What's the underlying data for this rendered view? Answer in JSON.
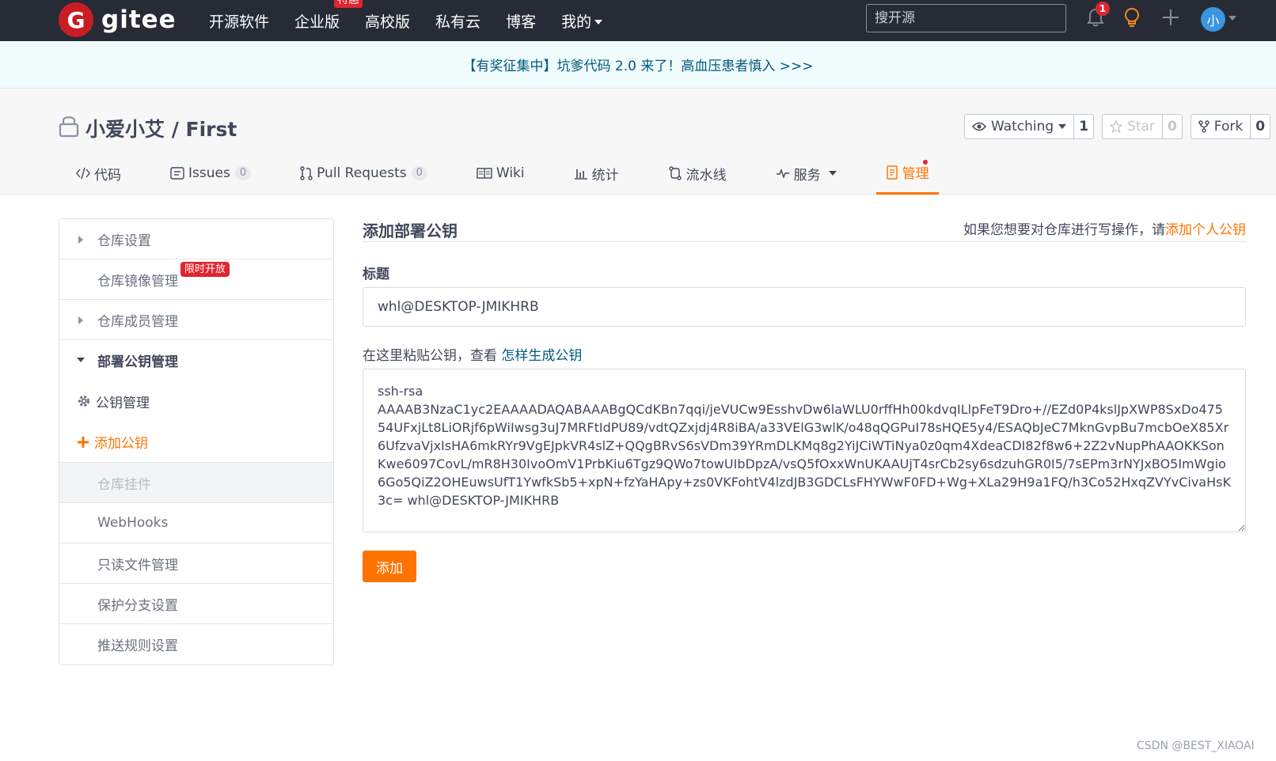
{
  "navbar": {
    "logo_letter": "G",
    "logo_text": "gitee",
    "links": [
      {
        "label": "开源软件"
      },
      {
        "label": "企业版",
        "badge": "特惠"
      },
      {
        "label": "高校版"
      },
      {
        "label": "私有云"
      },
      {
        "label": "博客"
      },
      {
        "label": "我的"
      }
    ],
    "search_placeholder": "搜开源",
    "notification_count": "1",
    "avatar_text": "小",
    "icons": [
      "bell-icon",
      "lightbulb-icon",
      "plus-icon"
    ]
  },
  "announcement": {
    "text": "【有奖征集中】坑爹代码 2.0 来了！高血压患者慎入 >>>"
  },
  "repo": {
    "title": "小爱小艾 / First",
    "watch_label": "Watching",
    "watch_count": "1",
    "star_label": "Star",
    "star_count": "0",
    "fork_label": "Fork",
    "fork_count": "0",
    "tabs": [
      {
        "label": "代码",
        "icon": "code-icon"
      },
      {
        "label": "Issues",
        "count": "0",
        "icon": "issues-icon"
      },
      {
        "label": "Pull Requests",
        "count": "0",
        "icon": "pull-request-icon"
      },
      {
        "label": "Wiki",
        "icon": "book-icon"
      },
      {
        "label": "统计",
        "icon": "bar-chart-icon"
      },
      {
        "label": "流水线",
        "icon": "pipeline-icon"
      },
      {
        "label": "服务",
        "icon": "pulse-icon"
      },
      {
        "label": "管理",
        "icon": "manage-icon",
        "active": true
      }
    ]
  },
  "sidebar": {
    "items": [
      {
        "label": "仓库设置"
      },
      {
        "label": "仓库镜像管理",
        "badge": "限时开放"
      },
      {
        "label": "仓库成员管理"
      },
      {
        "label": "部署公钥管理"
      },
      {
        "label": "公钥管理"
      },
      {
        "label": "添加公钥"
      },
      {
        "label": "仓库挂件"
      },
      {
        "label": "WebHooks"
      },
      {
        "label": "只读文件管理"
      },
      {
        "label": "保护分支设置"
      },
      {
        "label": "推送规则设置"
      }
    ]
  },
  "form": {
    "heading": "添加部署公钥",
    "hint_prefix": "如果您想要对仓库进行写操作，请",
    "hint_link": "添加个人公钥",
    "title_label": "标题",
    "title_value": "whl@DESKTOP-JMIKHRB",
    "key_label_prefix": "在这里粘贴公钥，查看",
    "key_label_link": "怎样生成公钥",
    "key_value": "ssh-rsa\nAAAAB3NzaC1yc2EAAAADAQABAAABgQCdKBn7qqi/jeVUCw9EsshvDw6laWLU0rffHh00kdvqILlpFeT9Dro+//EZd0P4kslJpXWP8SxDo47554UFxjLt8LiORjf6pWiIwsg3uJ7MRFtIdPU89/vdtQZxjdj4R8iBA/a33VElG3wlK/o48qQGPuI78sHQE5y4/ESAQbJeC7MknGvpBu7mcbOeX85Xr6UfzvaVjxIsHA6mkRYr9VgEJpkVR4slZ+QQgBRvS6sVDm39YRmDLKMq8g2YiJCiWTiNya0z0qm4XdeaCDI82f8w6+2Z2vNupPhAAOKKSonKwe6097CovL/mR8H30IvoOmV1PrbKiu6Tgz9QWo7towUIbDpzA/vsQ5fOxxWnUKAAUjT4srCb2sy6sdzuhGR0I5/7sEPm3rNYJxBO5ImWgio6Go5QiZ2OHEuwsUfT1YwfkSb5+xpN+fzYaHApy+zs0VKFohtV4lzdJB3GDCLsFHYWwF0FD+Wg+XLa29H9a1FQ/h3Co52HxqZVYvCivaHsK3c= whl@DESKTOP-JMIKHRB",
    "submit_label": "添加"
  },
  "watermark": "CSDN @BEST_XIAOAI",
  "colors": {
    "accent": "#fe7300",
    "navbar_bg": "#262b36",
    "badge_red": "#e0252f",
    "link_blue": "#005980"
  }
}
